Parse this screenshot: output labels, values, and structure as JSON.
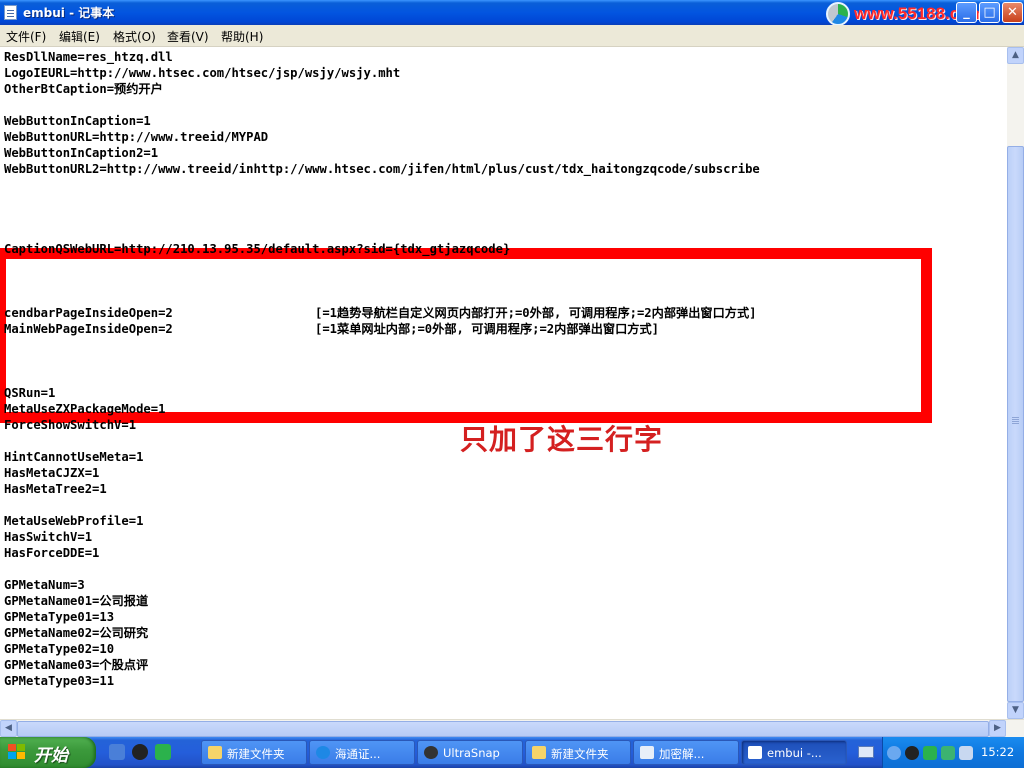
{
  "window": {
    "title": "embui - 记事本",
    "watermark": "www.55188.com",
    "buttons": {
      "minimize": "_",
      "maximize": "□",
      "close": "✕"
    }
  },
  "menu": [
    "文件(F)",
    "编辑(E)",
    "格式(O)",
    "查看(V)",
    "帮助(H)"
  ],
  "editor": {
    "lines": [
      "ResDllName=res_htzq.dll",
      "LogoIEURL=http://www.htsec.com/htsec/jsp/wsjy/wsjy.mht",
      "OtherBtCaption=预约开户",
      "",
      "WebButtonInCaption=1",
      "WebButtonURL=http://www.treeid/MYPAD",
      "WebButtonInCaption2=1",
      "WebButtonURL2=http://www.treeid/inhttp://www.htsec.com/jifen/html/plus/cust/tdx_haitongzqcode/subscribe",
      "",
      "",
      "",
      "",
      "CaptionQSWebURL=http://210.13.95.35/default.aspx?sid={tdx_gtjazqcode}",
      "",
      "",
      "",
      "cendbarPageInsideOpen=2",
      "MainWebPageInsideOpen=2",
      "",
      "",
      "",
      "QSRun=1",
      "MetaUseZXPackageMode=1",
      "ForceShowSwitchV=1",
      "",
      "HintCannotUseMeta=1",
      "HasMetaCJZX=1",
      "HasMetaTree2=1",
      "",
      "MetaUseWebProfile=1",
      "HasSwitchV=1",
      "HasForceDDE=1",
      "",
      "GPMetaNum=3",
      "GPMetaName01=公司报道",
      "GPMetaType01=13",
      "GPMetaName02=公司研究",
      "GPMetaType02=10",
      "GPMetaName03=个股点评",
      "GPMetaType03=11"
    ],
    "comments": {
      "16": "[=1趋势导航栏自定义网页内部打开;=0外部, 可调用程序;=2内部弹出窗口方式]",
      "17": "[=1菜单网址内部;=0外部, 可调用程序;=2内部弹出窗口方式]"
    },
    "annotation": "只加了这三行字"
  },
  "taskbar": {
    "start": "开始",
    "tasks": [
      "新建文件夹",
      "海通证...",
      "UltraSnap",
      "新建文件夹",
      "加密解...",
      "embui -..."
    ],
    "clock": "15:22"
  }
}
